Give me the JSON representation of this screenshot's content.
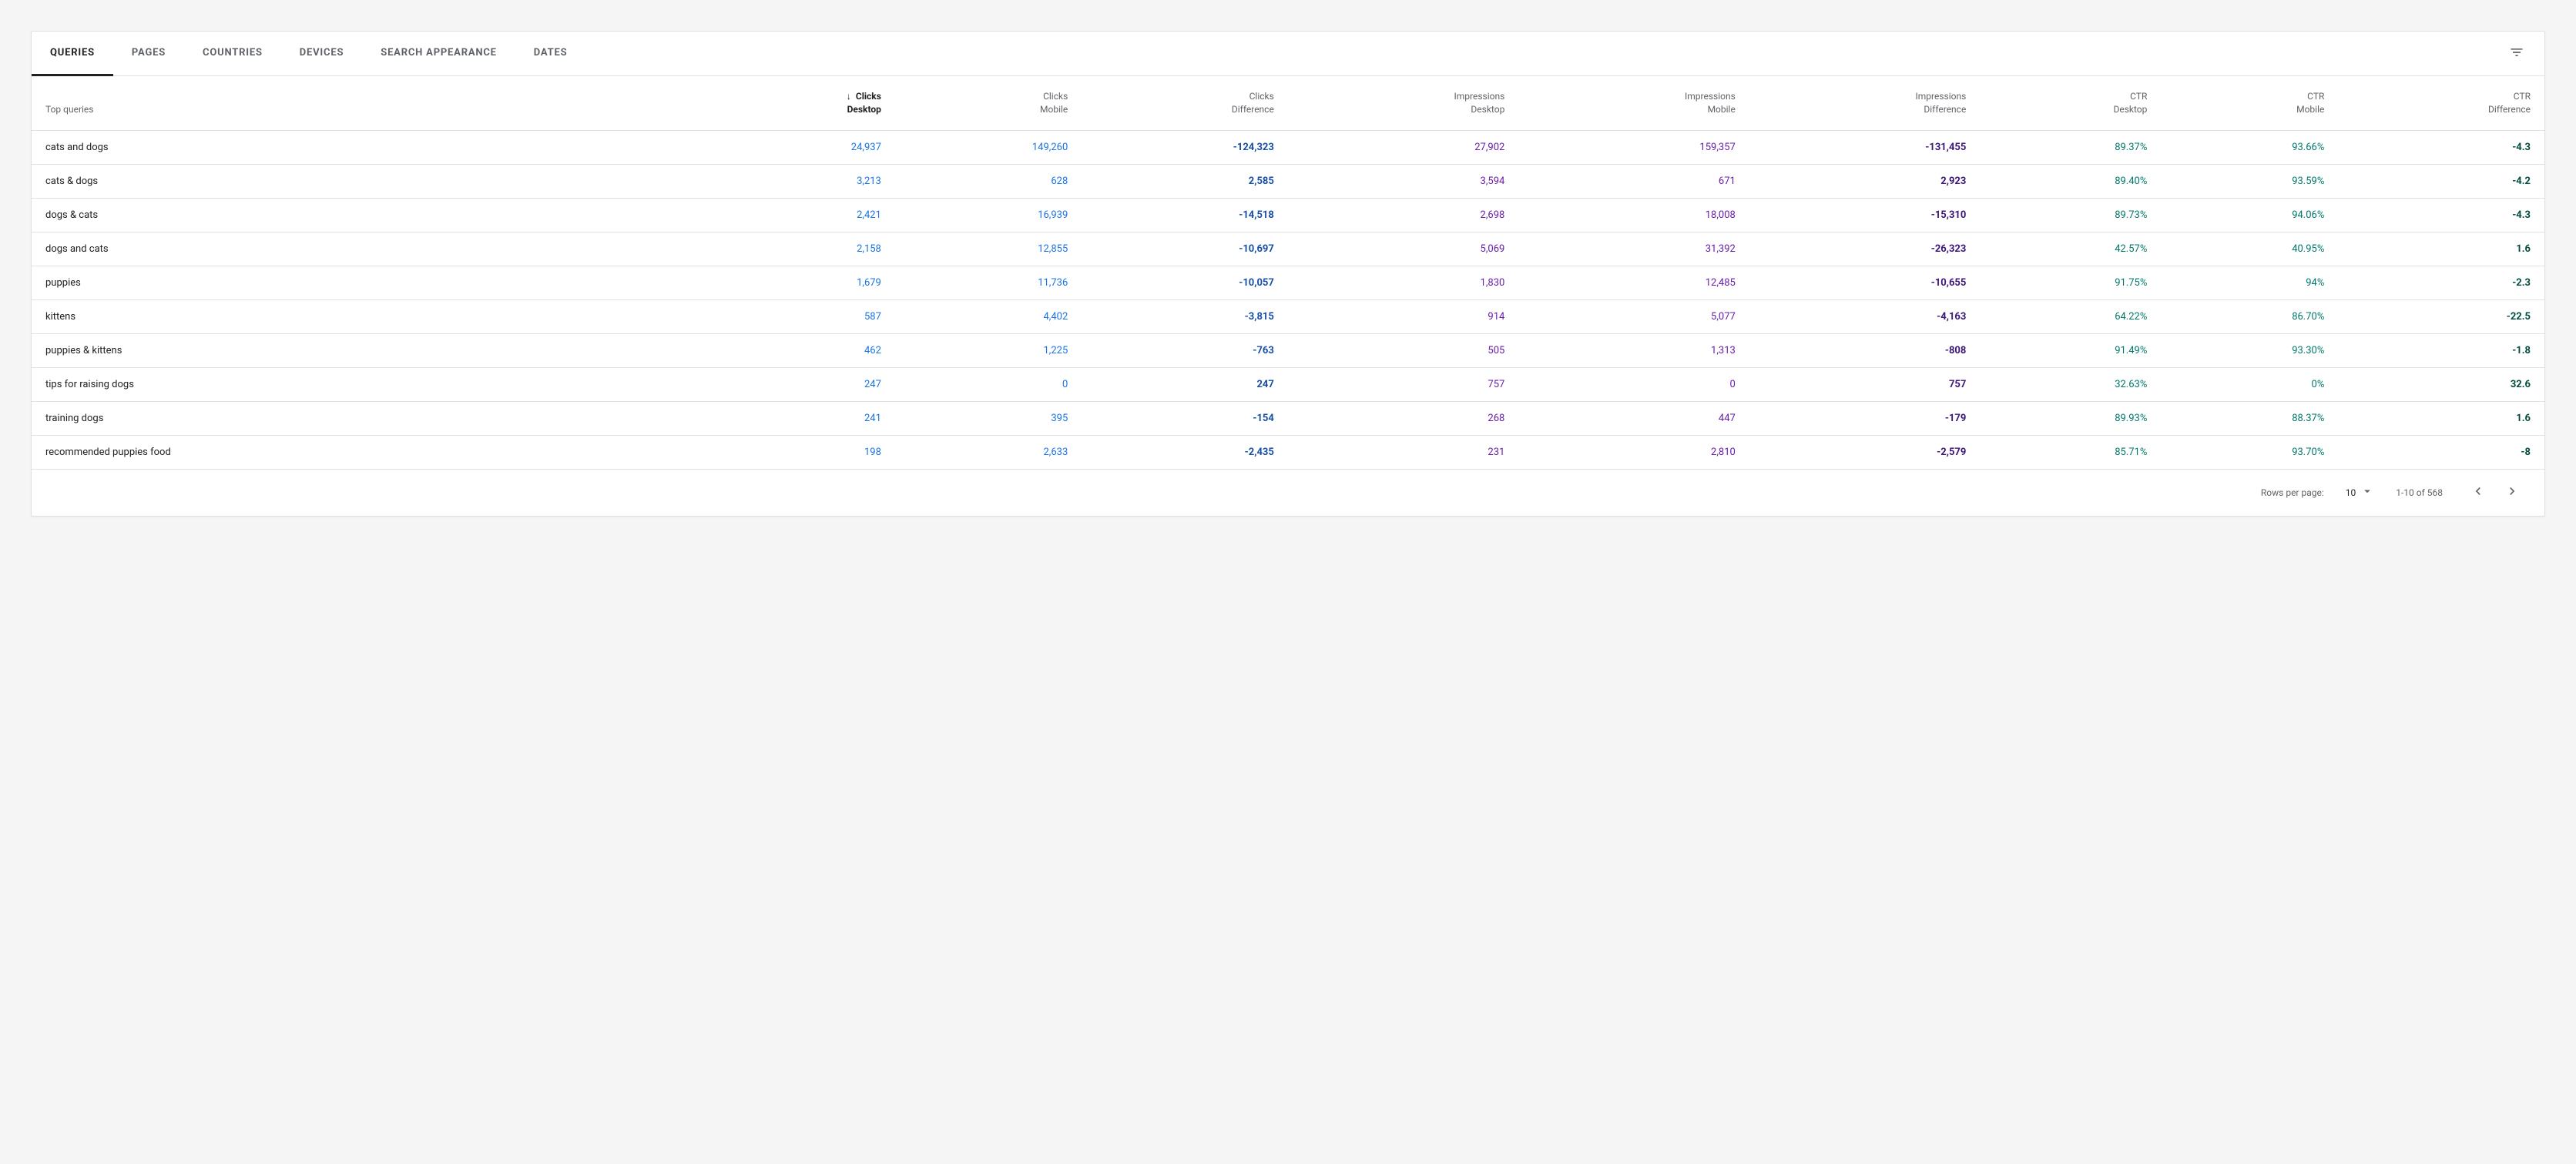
{
  "tabs": [
    {
      "label": "QUERIES",
      "active": true
    },
    {
      "label": "PAGES",
      "active": false
    },
    {
      "label": "COUNTRIES",
      "active": false
    },
    {
      "label": "DEVICES",
      "active": false
    },
    {
      "label": "SEARCH APPEARANCE",
      "active": false
    },
    {
      "label": "DATES",
      "active": false
    }
  ],
  "table": {
    "columns": [
      {
        "l1": "",
        "l2": "Top queries",
        "type": "query"
      },
      {
        "l1": "Clicks",
        "l2": "Desktop",
        "type": "blue",
        "sorted": true
      },
      {
        "l1": "Clicks",
        "l2": "Mobile",
        "type": "blue"
      },
      {
        "l1": "Clicks",
        "l2": "Difference",
        "type": "blue-b"
      },
      {
        "l1": "Impressions",
        "l2": "Desktop",
        "type": "purple"
      },
      {
        "l1": "Impressions",
        "l2": "Mobile",
        "type": "purple"
      },
      {
        "l1": "Impressions",
        "l2": "Difference",
        "type": "purple-b"
      },
      {
        "l1": "CTR",
        "l2": "Desktop",
        "type": "teal"
      },
      {
        "l1": "CTR",
        "l2": "Mobile",
        "type": "teal"
      },
      {
        "l1": "CTR",
        "l2": "Difference",
        "type": "teal-b"
      }
    ],
    "rows": [
      {
        "query": "cats and dogs",
        "cells": [
          "24,937",
          "149,260",
          "-124,323",
          "27,902",
          "159,357",
          "-131,455",
          "89.37%",
          "93.66%",
          "-4.3"
        ]
      },
      {
        "query": "cats & dogs",
        "cells": [
          "3,213",
          "628",
          "2,585",
          "3,594",
          "671",
          "2,923",
          "89.40%",
          "93.59%",
          "-4.2"
        ]
      },
      {
        "query": "dogs & cats",
        "cells": [
          "2,421",
          "16,939",
          "-14,518",
          "2,698",
          "18,008",
          "-15,310",
          "89.73%",
          "94.06%",
          "-4.3"
        ]
      },
      {
        "query": "dogs and cats",
        "cells": [
          "2,158",
          "12,855",
          "-10,697",
          "5,069",
          "31,392",
          "-26,323",
          "42.57%",
          "40.95%",
          "1.6"
        ]
      },
      {
        "query": "puppies",
        "cells": [
          "1,679",
          "11,736",
          "-10,057",
          "1,830",
          "12,485",
          "-10,655",
          "91.75%",
          "94%",
          "-2.3"
        ]
      },
      {
        "query": "kittens",
        "cells": [
          "587",
          "4,402",
          "-3,815",
          "914",
          "5,077",
          "-4,163",
          "64.22%",
          "86.70%",
          "-22.5"
        ]
      },
      {
        "query": "puppies & kittens",
        "cells": [
          "462",
          "1,225",
          "-763",
          "505",
          "1,313",
          "-808",
          "91.49%",
          "93.30%",
          "-1.8"
        ]
      },
      {
        "query": "tips for raising dogs",
        "cells": [
          "247",
          "0",
          "247",
          "757",
          "0",
          "757",
          "32.63%",
          "0%",
          "32.6"
        ]
      },
      {
        "query": "training dogs",
        "cells": [
          "241",
          "395",
          "-154",
          "268",
          "447",
          "-179",
          "89.93%",
          "88.37%",
          "1.6"
        ]
      },
      {
        "query": "recommended puppies food",
        "cells": [
          "198",
          "2,633",
          "-2,435",
          "231",
          "2,810",
          "-2,579",
          "85.71%",
          "93.70%",
          "-8"
        ]
      }
    ]
  },
  "footer": {
    "rows_per_page_label": "Rows per page:",
    "rows_per_page_value": "10",
    "range": "1-10 of 568"
  }
}
